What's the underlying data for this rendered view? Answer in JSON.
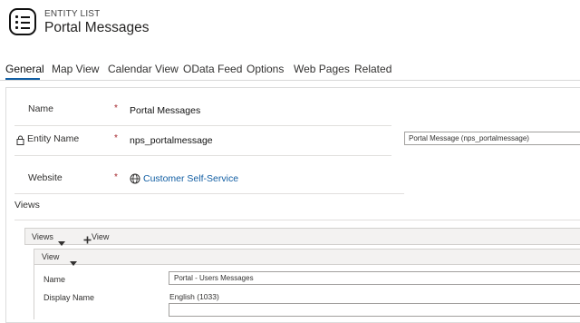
{
  "header": {
    "entity_type": "ENTITY LIST",
    "title": "Portal Messages"
  },
  "tabs": [
    {
      "label": "General",
      "active": true
    },
    {
      "label": "Map View"
    },
    {
      "label": "Calendar View"
    },
    {
      "label": "OData Feed"
    },
    {
      "label": "Options"
    },
    {
      "label": "Web Pages"
    },
    {
      "label": "Related"
    }
  ],
  "form": {
    "name": {
      "label": "Name",
      "required": "*",
      "value": "Portal Messages"
    },
    "entity_name": {
      "label": "Entity Name",
      "required": "*",
      "value": "nps_portalmessage",
      "lookup_value": "Portal Message (nps_portalmessage)"
    },
    "website": {
      "label": "Website",
      "required": "*",
      "value": "Customer Self-Service"
    }
  },
  "views_section": {
    "label": "Views",
    "views_bar_label": "Views",
    "add_view_label": "View",
    "view_bar_label": "View",
    "name_label": "Name",
    "name_value": "Portal - Users Messages",
    "display_name_label": "Display Name",
    "display_name_language": "English (1033)"
  },
  "colors": {
    "accent": "#115ea3",
    "required": "#a4262c",
    "border": "#d2d0ce"
  },
  "icons": [
    "entity-list-icon",
    "lock-icon",
    "globe-icon",
    "caret-down-icon",
    "plus-icon"
  ]
}
